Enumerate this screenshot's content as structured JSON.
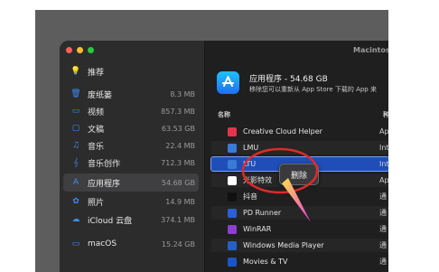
{
  "window_title": "Macintos",
  "sidebar": {
    "items": [
      {
        "icon": "lightbulb-icon",
        "glyph": "💡",
        "label": "推荐",
        "size": ""
      },
      {
        "icon": "trash-icon",
        "glyph": "🗑",
        "label": "废纸篓",
        "size": "8.3 MB"
      },
      {
        "icon": "tv-icon",
        "glyph": "▭",
        "label": "视频",
        "size": "857.3 MB"
      },
      {
        "icon": "document-icon",
        "glyph": "▢",
        "label": "文稿",
        "size": "63.53 GB"
      },
      {
        "icon": "music-note-icon",
        "glyph": "♫",
        "label": "音乐",
        "size": "22.4 MB"
      },
      {
        "icon": "music-creation-icon",
        "glyph": "𝄞",
        "label": "音乐创作",
        "size": "712.3 MB"
      },
      {
        "icon": "app-store-icon",
        "glyph": "A",
        "label": "应用程序",
        "size": "54.68 GB"
      },
      {
        "icon": "photos-icon",
        "glyph": "✿",
        "label": "照片",
        "size": "14.9 MB"
      },
      {
        "icon": "cloud-icon",
        "glyph": "☁",
        "label": "iCloud 云盘",
        "size": "374.1 MB"
      },
      {
        "icon": "macos-icon",
        "glyph": "▭",
        "label": "macOS",
        "size": "15.24 GB"
      }
    ],
    "selected_index": 6
  },
  "header": {
    "title": "应用程序 - 54.68 GB",
    "subtitle": "移除您可以重新从 App Store 下载的 App 来"
  },
  "columns": {
    "name": "名称",
    "kind": "种"
  },
  "apps": [
    {
      "icon": "creative-cloud-icon",
      "color": "#e5334f",
      "label": "Creative Cloud Helper",
      "kind": "Ap"
    },
    {
      "icon": "lmu-icon",
      "color": "#3a7bd5",
      "label": "LMU",
      "kind": "Int"
    },
    {
      "icon": "ltu-icon",
      "color": "#3a7bd5",
      "label": "LTU",
      "kind": "Int"
    },
    {
      "icon": "lightroom-icon",
      "color": "#ffffff",
      "label": "光影特效",
      "kind": "Ap"
    },
    {
      "icon": "tiktok-icon",
      "color": "#111111",
      "label": "抖音",
      "kind": "通"
    },
    {
      "icon": "pd-runner-icon",
      "color": "#2a5fd9",
      "label": "PD Runner",
      "kind": "通"
    },
    {
      "icon": "winrar-icon",
      "color": "#8e3fd1",
      "label": "WinRAR",
      "kind": "通"
    },
    {
      "icon": "windows-media-player-icon",
      "color": "#2561c4",
      "label": "Windows Media Player",
      "kind": "通"
    },
    {
      "icon": "movies-tv-icon",
      "color": "#1c56c6",
      "label": "Movies & TV",
      "kind": "通"
    }
  ],
  "selected_app_index": 2,
  "context_menu": {
    "delete_label": "删除"
  },
  "colors": {
    "accent": "#1f4eb8",
    "annotation": "#e02a2a"
  }
}
